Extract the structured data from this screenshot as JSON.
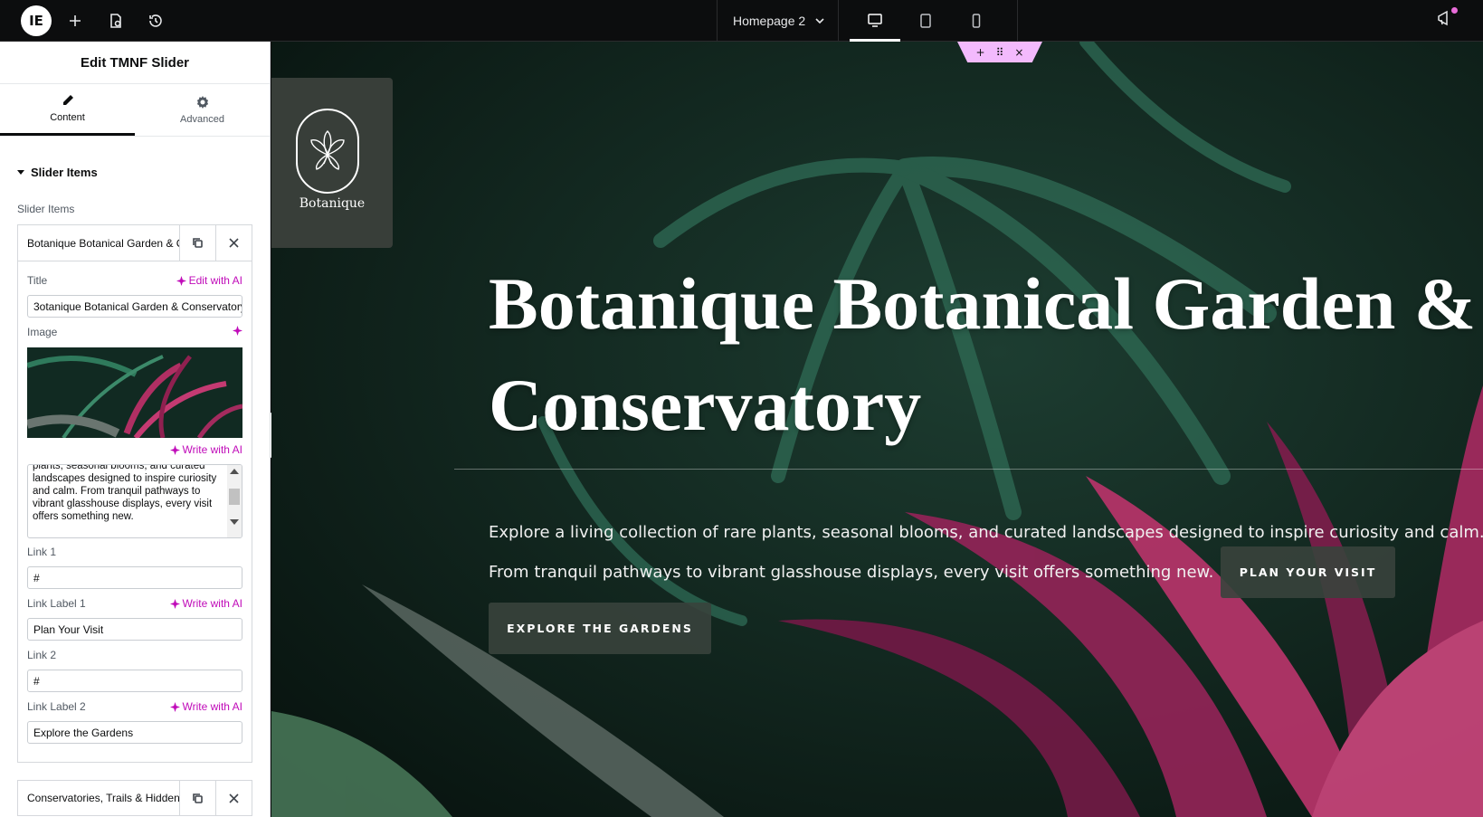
{
  "topbar": {
    "page_name": "Homepage 2",
    "icons": [
      "elementor-logo-icon",
      "add-icon",
      "page-settings-icon",
      "history-icon",
      "chevron-down-icon",
      "desktop-icon",
      "tablet-icon",
      "mobile-icon",
      "notifications-icon"
    ],
    "logo_text": "IE",
    "notification_dot_color": "#e86cd8"
  },
  "sidebar": {
    "title": "Edit TMNF Slider",
    "tabs": [
      {
        "label": "Content",
        "icon": "pencil-icon",
        "active": true
      },
      {
        "label": "Advanced",
        "icon": "gear-icon",
        "active": false
      }
    ],
    "section_title": "Slider Items",
    "items_label": "Slider Items",
    "item1": {
      "title": "Botanique Botanical Garden & C",
      "fields": {
        "title_label": "Title",
        "title_ai": "Edit with AI",
        "title_value": "3otanique Botanical Garden & Conservatory",
        "image_label": "Image",
        "description_ai": "Write with AI",
        "description_value": "plants, seasonal blooms, and curated landscapes designed to inspire curiosity and calm. From tranquil pathways to vibrant glasshouse displays, every visit offers something new.",
        "link1_label": "Link 1",
        "link1_value": "#",
        "link_label1_label": "Link Label 1",
        "link_label1_ai": "Write with AI",
        "link_label1_value": "Plan Your Visit",
        "link2_label": "Link 2",
        "link2_value": "#",
        "link_label2_label": "Link Label 2",
        "link_label2_ai": "Write with AI",
        "link_label2_value": "Explore the Gardens"
      }
    },
    "item2": {
      "title": "Conservatories, Trails & Hidden"
    }
  },
  "canvas": {
    "handle_icons": [
      "+",
      "⠿",
      "×"
    ],
    "brand_name": "Botanique",
    "hero_title_line1": "Botanique Botanical Garden &",
    "hero_title_line2": "Conservatory",
    "hero_desc_line1": "Explore a living collection of rare plants, seasonal blooms, and curated landscapes designed to inspire curiosity and calm.",
    "hero_desc_line2": "From tranquil pathways to vibrant glasshouse displays, every visit offers something new.",
    "button_primary": "PLAN YOUR VISIT",
    "button_secondary": "EXPLORE THE GARDENS",
    "accent_color": "#c00bb9",
    "handle_color": "#f3bafd"
  }
}
